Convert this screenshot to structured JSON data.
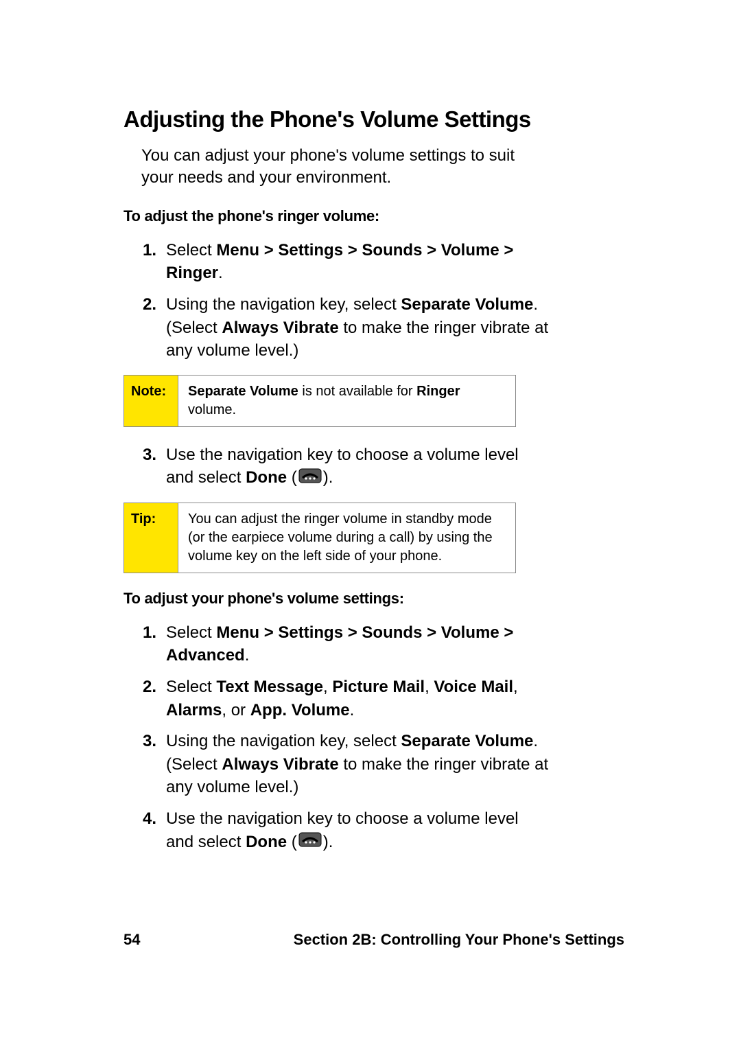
{
  "heading": "Adjusting the Phone's Volume Settings",
  "intro": "You can adjust your phone's volume settings to suit your needs and your environment.",
  "section1": {
    "subhead": "To adjust the phone's ringer volume:",
    "step1_prefix": "Select ",
    "step1_bold": "Menu > Settings > Sounds > Volume > Ringer",
    "step1_suffix": ".",
    "step2_p1": "Using the navigation key, select ",
    "step2_b1": "Separate Volume",
    "step2_p2": ". (Select ",
    "step2_b2": "Always Vibrate",
    "step2_p3": " to make the ringer vibrate at any volume level.)",
    "step3_p1": "Use the navigation key to choose a volume level and select ",
    "step3_b1": "Done",
    "step3_p2": " (",
    "step3_p3": ")."
  },
  "note": {
    "label": "Note:",
    "b1": "Separate Volume",
    "p1": " is not available for ",
    "b2": "Ringer",
    "p2": " volume."
  },
  "tip": {
    "label": "Tip:",
    "text": "You can adjust the ringer volume in standby mode (or the earpiece volume during a call) by using the volume key on the left side of your phone."
  },
  "section2": {
    "subhead": "To adjust your phone's volume settings:",
    "step1_prefix": "Select ",
    "step1_bold": "Menu > Settings > Sounds > Volume > Advanced",
    "step1_suffix": ".",
    "step2_p1": "Select ",
    "step2_b1": "Text Message",
    "step2_c1": ", ",
    "step2_b2": "Picture Mail",
    "step2_c2": ", ",
    "step2_b3": "Voice Mail",
    "step2_c3": ", ",
    "step2_b4": "Alarms",
    "step2_c4": ", or ",
    "step2_b5": "App. Volume",
    "step2_suffix": ".",
    "step3_p1": "Using the navigation key, select ",
    "step3_b1": "Separate Volume",
    "step3_p2": ". (Select ",
    "step3_b2": "Always Vibrate",
    "step3_p3": " to make the ringer vibrate at any volume level.)",
    "step4_p1": "Use the navigation key to choose a volume level and select ",
    "step4_b1": "Done",
    "step4_p2": " (",
    "step4_p3": ")."
  },
  "footer": {
    "page": "54",
    "section": "Section 2B: Controlling Your Phone's Settings"
  }
}
